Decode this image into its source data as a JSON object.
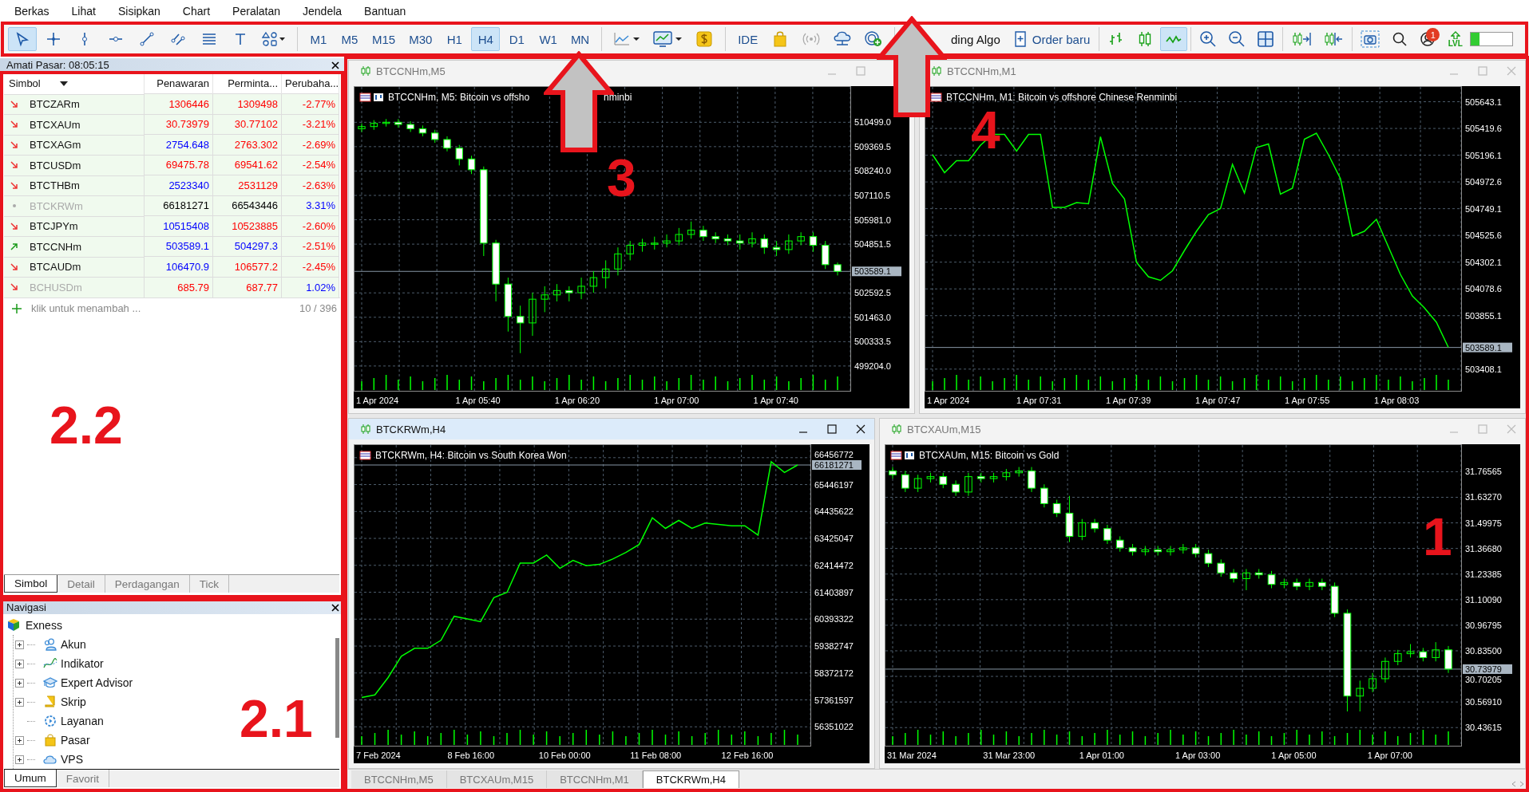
{
  "menu": [
    "Berkas",
    "Lihat",
    "Sisipkan",
    "Chart",
    "Peralatan",
    "Jendela",
    "Bantuan"
  ],
  "toolbar": {
    "drawing_tools": [
      {
        "kind": "cursor",
        "selected": true
      },
      {
        "kind": "crosshair",
        "selected": false
      },
      {
        "kind": "vline",
        "selected": false
      },
      {
        "kind": "hline",
        "selected": false
      },
      {
        "kind": "trendline",
        "selected": false
      },
      {
        "kind": "channel",
        "selected": false
      },
      {
        "kind": "fibo",
        "selected": false
      },
      {
        "kind": "text",
        "selected": false
      },
      {
        "kind": "shapes",
        "selected": false
      }
    ],
    "timeframes": [
      {
        "label": "M1",
        "selected": false
      },
      {
        "label": "M5",
        "selected": false
      },
      {
        "label": "M15",
        "selected": false
      },
      {
        "label": "M30",
        "selected": false
      },
      {
        "label": "H1",
        "selected": false
      },
      {
        "label": "H4",
        "selected": true
      },
      {
        "label": "D1",
        "selected": false
      },
      {
        "label": "W1",
        "selected": false
      },
      {
        "label": "MN",
        "selected": false
      }
    ],
    "ide_label": "IDE",
    "algo_label": "ding Algo",
    "order_label": "Order baru",
    "chart_types": [
      {
        "kind": "bars",
        "selected": false
      },
      {
        "kind": "candles",
        "selected": false
      },
      {
        "kind": "line",
        "selected": true
      }
    ],
    "notification_badge": "1",
    "level_label": "LVL",
    "meter": {
      "level": 0.2
    }
  },
  "market_watch": {
    "title": "Amati Pasar: 08:05:15",
    "columns": [
      "Simbol",
      "Penawaran",
      "Perminta...",
      "Perubaha..."
    ],
    "rows": [
      {
        "kind": "falling",
        "symbol": "BTCZARm",
        "inactive": false,
        "bid": {
          "text": "1306446",
          "color": "#ff0000"
        },
        "ask": {
          "text": "1309498",
          "color": "#ff0000"
        },
        "change": {
          "text": "-2.77%",
          "color": "#ff0000"
        }
      },
      {
        "kind": "falling",
        "symbol": "BTCXAUm",
        "inactive": false,
        "bid": {
          "text": "30.73979",
          "color": "#ff0000"
        },
        "ask": {
          "text": "30.77102",
          "color": "#ff0000"
        },
        "change": {
          "text": "-3.21%",
          "color": "#ff0000"
        }
      },
      {
        "kind": "falling",
        "symbol": "BTCXAGm",
        "inactive": false,
        "bid": {
          "text": "2754.648",
          "color": "#0000ff"
        },
        "ask": {
          "text": "2763.302",
          "color": "#ff0000"
        },
        "change": {
          "text": "-2.69%",
          "color": "#ff0000"
        }
      },
      {
        "kind": "falling",
        "symbol": "BTCUSDm",
        "inactive": false,
        "bid": {
          "text": "69475.78",
          "color": "#ff0000"
        },
        "ask": {
          "text": "69541.62",
          "color": "#ff0000"
        },
        "change": {
          "text": "-2.54%",
          "color": "#ff0000"
        }
      },
      {
        "kind": "falling",
        "symbol": "BTCTHBm",
        "inactive": false,
        "bid": {
          "text": "2523340",
          "color": "#0000ff"
        },
        "ask": {
          "text": "2531129",
          "color": "#ff0000"
        },
        "change": {
          "text": "-2.63%",
          "color": "#ff0000"
        }
      },
      {
        "kind": "unchanged",
        "symbol": "BTCKRWm",
        "inactive": true,
        "bid": {
          "text": "66181271",
          "color": "#000000"
        },
        "ask": {
          "text": "66543446",
          "color": "#000000"
        },
        "change": {
          "text": "3.31%",
          "color": "#0000ff"
        }
      },
      {
        "kind": "falling",
        "symbol": "BTCJPYm",
        "inactive": false,
        "bid": {
          "text": "10515408",
          "color": "#0000ff"
        },
        "ask": {
          "text": "10523885",
          "color": "#ff0000"
        },
        "change": {
          "text": "-2.60%",
          "color": "#ff0000"
        }
      },
      {
        "kind": "rising",
        "symbol": "BTCCNHm",
        "inactive": false,
        "bid": {
          "text": "503589.1",
          "color": "#0000ff"
        },
        "ask": {
          "text": "504297.3",
          "color": "#0000ff"
        },
        "change": {
          "text": "-2.51%",
          "color": "#ff0000"
        }
      },
      {
        "kind": "falling",
        "symbol": "BTCAUDm",
        "inactive": false,
        "bid": {
          "text": "106470.9",
          "color": "#0000ff"
        },
        "ask": {
          "text": "106577.2",
          "color": "#ff0000"
        },
        "change": {
          "text": "-2.45%",
          "color": "#ff0000"
        }
      },
      {
        "kind": "falling",
        "symbol": "BCHUSDm",
        "inactive": true,
        "bid": {
          "text": "685.79",
          "color": "#ff0000"
        },
        "ask": {
          "text": "687.77",
          "color": "#ff0000"
        },
        "change": {
          "text": "1.02%",
          "color": "#0000ff"
        }
      }
    ],
    "add_label": "klik untuk menambah ...",
    "count": "10 / 396",
    "tabs": [
      {
        "label": "Simbol",
        "selected": true
      },
      {
        "label": "Detail",
        "selected": false
      },
      {
        "label": "Perdagangan",
        "selected": false
      },
      {
        "label": "Tick",
        "selected": false
      }
    ]
  },
  "navigator": {
    "title": "Navigasi",
    "tree": [
      {
        "label": "Exness",
        "children": [
          {
            "label": "Akun",
            "expanded": false
          },
          {
            "label": "Indikator",
            "expanded": false
          },
          {
            "label": "Expert Advisor",
            "expanded": false
          },
          {
            "label": "Skrip",
            "expanded": false
          },
          {
            "label": "Layanan"
          },
          {
            "label": "Pasar",
            "expanded": false
          },
          {
            "label": "VPS",
            "expanded": false
          }
        ]
      }
    ],
    "tabs": [
      {
        "label": "Umum",
        "selected": true
      },
      {
        "label": "Favorit",
        "selected": false
      }
    ]
  },
  "charts": [
    {
      "title": "BTCCNHm,M5",
      "active": false,
      "closable": false,
      "header": "BTCCNHm, M5:  Bitcoin vs offsho",
      "header_tail": "nminbi",
      "time_labels": [
        "1 Apr 2024",
        "1 Apr 05:40",
        "1 Apr 06:20",
        "1 Apr 07:00",
        "1 Apr 07:40"
      ],
      "chart_data": {
        "type": "candlestick",
        "grid": true,
        "ylim": [
          498128,
          512100
        ],
        "yticks": [
          {
            "value": 510499.0,
            "label": "510499.0"
          },
          {
            "value": 509369.5,
            "label": "509369.5"
          },
          {
            "value": 508240.0,
            "label": "508240.0"
          },
          {
            "value": 507110.5,
            "label": "507110.5"
          },
          {
            "value": 505981.0,
            "label": "505981.0"
          },
          {
            "value": 504851.5,
            "label": "504851.5"
          },
          {
            "value": 502592.5,
            "label": "502592.5"
          },
          {
            "value": 501463.0,
            "label": "501463.0"
          },
          {
            "value": 500333.5,
            "label": "500333.5"
          },
          {
            "value": 499204.0,
            "label": "499204.0"
          }
        ],
        "ref_lines": [
          {
            "axis": "y",
            "value": 503589.1,
            "label": "503589.1"
          }
        ],
        "ohlc": [
          [
            510200,
            510450,
            510050,
            510300
          ],
          [
            510300,
            510600,
            510150,
            510450
          ],
          [
            510450,
            510650,
            510300,
            510500
          ],
          [
            510500,
            510650,
            510250,
            510400
          ],
          [
            510400,
            510550,
            510050,
            510200
          ],
          [
            510200,
            510350,
            509850,
            510000
          ],
          [
            510000,
            510150,
            509550,
            509700
          ],
          [
            509700,
            509850,
            509150,
            509300
          ],
          [
            509300,
            509450,
            508500,
            508800
          ],
          [
            508800,
            508950,
            508100,
            508300
          ],
          [
            508300,
            508450,
            504300,
            504900
          ],
          [
            504900,
            505050,
            502200,
            503000
          ],
          [
            503000,
            503300,
            500800,
            501500
          ],
          [
            501500,
            502000,
            499800,
            501200
          ],
          [
            501200,
            502600,
            500600,
            502300
          ],
          [
            502300,
            502900,
            501700,
            502500
          ],
          [
            502500,
            503000,
            502200,
            502700
          ],
          [
            502700,
            502900,
            502200,
            502600
          ],
          [
            502600,
            503300,
            502300,
            502900
          ],
          [
            502900,
            503600,
            502600,
            503300
          ],
          [
            503300,
            504100,
            502800,
            503700
          ],
          [
            503700,
            504700,
            503400,
            504400
          ],
          [
            504400,
            505000,
            504100,
            504800
          ],
          [
            504800,
            505100,
            504500,
            504900
          ],
          [
            504900,
            505200,
            504600,
            504900
          ],
          [
            504900,
            505300,
            504700,
            505000
          ],
          [
            505000,
            505600,
            504800,
            505300
          ],
          [
            505300,
            505900,
            505100,
            505500
          ],
          [
            505500,
            505700,
            505000,
            505200
          ],
          [
            505200,
            505400,
            504900,
            505100
          ],
          [
            505100,
            505300,
            504800,
            505000
          ],
          [
            505000,
            505300,
            504600,
            504900
          ],
          [
            504900,
            505400,
            504700,
            505100
          ],
          [
            505100,
            505300,
            504400,
            504700
          ],
          [
            504700,
            505000,
            504300,
            504600
          ],
          [
            504600,
            505300,
            504400,
            505000
          ],
          [
            505000,
            505400,
            504800,
            505200
          ],
          [
            505200,
            505400,
            504500,
            504800
          ],
          [
            504800,
            505000,
            503700,
            503900
          ],
          [
            503900,
            504000,
            503400,
            503590
          ]
        ]
      }
    },
    {
      "title": "BTCCNHm,M1",
      "active": false,
      "closable": true,
      "header": "BTCCNHm, M1:  Bitcoin vs offshore Chinese Renminbi",
      "time_labels": [
        "1 Apr 2024",
        "1 Apr 07:31",
        "1 Apr 07:39",
        "1 Apr 07:47",
        "1 Apr 07:55",
        "1 Apr 08:03"
      ],
      "chart_data": {
        "type": "line",
        "grid": true,
        "ylim": [
          503240,
          505760
        ],
        "yticks": [
          {
            "value": 505643.1,
            "label": "505643.1"
          },
          {
            "value": 505419.6,
            "label": "505419.6"
          },
          {
            "value": 505196.1,
            "label": "505196.1"
          },
          {
            "value": 504972.6,
            "label": "504972.6"
          },
          {
            "value": 504749.1,
            "label": "504749.1"
          },
          {
            "value": 504525.6,
            "label": "504525.6"
          },
          {
            "value": 504302.1,
            "label": "504302.1"
          },
          {
            "value": 504078.6,
            "label": "504078.6"
          },
          {
            "value": 503855.1,
            "label": "503855.1"
          },
          {
            "value": 503408.1,
            "label": "503408.1"
          }
        ],
        "ref_lines": [
          {
            "axis": "y",
            "value": 503589.1,
            "label": "503589.1"
          }
        ],
        "series": [
          {
            "color": "#00ff00",
            "values": [
              505200,
              505050,
              505150,
              505150,
              505280,
              505370,
              505370,
              505230,
              505370,
              505370,
              504760,
              504760,
              504800,
              504790,
              505350,
              504960,
              504830,
              504300,
              504180,
              504150,
              504230,
              504400,
              504560,
              504700,
              504750,
              505120,
              504880,
              505260,
              505290,
              504870,
              504920,
              505330,
              505380,
              505200,
              505000,
              504520,
              504560,
              504660,
              504430,
              504200,
              504020,
              503920,
              503800,
              503590
            ]
          }
        ]
      }
    },
    {
      "title": "BTCKRWm,H4",
      "active": true,
      "closable": true,
      "header": "BTCKRWm, H4:  Bitcoin vs South Korea Won",
      "time_labels": [
        "7 Feb 2024",
        "8 Feb 16:00",
        "10 Feb 00:00",
        "11 Feb 08:00",
        "12 Feb 16:00"
      ],
      "chart_data": {
        "type": "line",
        "grid": true,
        "ylim": [
          55700000,
          66900000
        ],
        "yticks": [
          {
            "value": 66456772,
            "label": "66456772"
          },
          {
            "value": 65446197,
            "label": "65446197"
          },
          {
            "value": 64435622,
            "label": "64435622"
          },
          {
            "value": 63425047,
            "label": "63425047"
          },
          {
            "value": 62414472,
            "label": "62414472"
          },
          {
            "value": 61403897,
            "label": "61403897"
          },
          {
            "value": 60393322,
            "label": "60393322"
          },
          {
            "value": 59382747,
            "label": "59382747"
          },
          {
            "value": 58372172,
            "label": "58372172"
          },
          {
            "value": 57361597,
            "label": "57361597"
          },
          {
            "value": 56351022,
            "label": "56351022"
          }
        ],
        "ref_lines": [
          {
            "axis": "y",
            "value": 66181271,
            "label": "66181271"
          }
        ],
        "series": [
          {
            "color": "#00ff00",
            "values": [
              57450000,
              57550000,
              58200000,
              59000000,
              59300000,
              59300000,
              59600000,
              60500000,
              60400000,
              60300000,
              61200000,
              61400000,
              62500000,
              62500000,
              62800000,
              62300000,
              62600000,
              62400000,
              62450000,
              62650000,
              62900000,
              63200000,
              64200000,
              63800000,
              64100000,
              63800000,
              64000000,
              63950000,
              63900000,
              63900000,
              63550000,
              66300000,
              65900000,
              66180000
            ]
          }
        ]
      }
    },
    {
      "title": "BTCXAUm,M15",
      "active": false,
      "closable": true,
      "header": "BTCXAUm, M15:  Bitcoin vs Gold",
      "time_labels": [
        "31 Mar 2024",
        "31 Mar 23:00",
        "1 Apr 01:00",
        "1 Apr 03:00",
        "1 Apr 05:00",
        "1 Apr 07:00"
      ],
      "chart_data": {
        "type": "candlestick",
        "grid": true,
        "ylim": [
          30.35,
          31.9
        ],
        "yticks": [
          {
            "value": 31.76565,
            "label": "31.76565"
          },
          {
            "value": 31.6327,
            "label": "31.63270"
          },
          {
            "value": 31.49975,
            "label": "31.49975"
          },
          {
            "value": 31.3668,
            "label": "31.36680"
          },
          {
            "value": 31.23385,
            "label": "31.23385"
          },
          {
            "value": 31.1009,
            "label": "31.10090"
          },
          {
            "value": 30.96795,
            "label": "30.96795"
          },
          {
            "value": 30.835,
            "label": "30.83500"
          },
          {
            "value": 30.70205,
            "label": "30.70205"
          },
          {
            "value": 30.5691,
            "label": "30.56910"
          },
          {
            "value": 30.43615,
            "label": "30.43615"
          }
        ],
        "ref_lines": [
          {
            "axis": "y",
            "value": 30.73979,
            "label": "30.73979"
          }
        ],
        "ohlc": [
          [
            31.77,
            31.79,
            31.73,
            31.75
          ],
          [
            31.75,
            31.77,
            31.66,
            31.68
          ],
          [
            31.68,
            31.75,
            31.66,
            31.73
          ],
          [
            31.73,
            31.76,
            31.71,
            31.74
          ],
          [
            31.74,
            31.76,
            31.68,
            31.7
          ],
          [
            31.7,
            31.72,
            31.64,
            31.66
          ],
          [
            31.66,
            31.76,
            31.64,
            31.74
          ],
          [
            31.74,
            31.76,
            31.71,
            31.73
          ],
          [
            31.73,
            31.76,
            31.71,
            31.74
          ],
          [
            31.74,
            31.78,
            31.72,
            31.76
          ],
          [
            31.76,
            31.79,
            31.74,
            31.77
          ],
          [
            31.77,
            31.79,
            31.66,
            31.68
          ],
          [
            31.68,
            31.7,
            31.58,
            31.6
          ],
          [
            31.6,
            31.62,
            31.53,
            31.55
          ],
          [
            31.55,
            31.64,
            31.4,
            31.43
          ],
          [
            31.43,
            31.52,
            31.41,
            31.5
          ],
          [
            31.5,
            31.52,
            31.45,
            31.47
          ],
          [
            31.47,
            31.49,
            31.39,
            31.41
          ],
          [
            31.41,
            31.43,
            31.35,
            31.37
          ],
          [
            31.37,
            31.39,
            31.33,
            31.35
          ],
          [
            31.35,
            31.38,
            31.33,
            31.36
          ],
          [
            31.36,
            31.38,
            31.33,
            31.35
          ],
          [
            31.35,
            31.38,
            31.33,
            31.36
          ],
          [
            31.36,
            31.39,
            31.34,
            31.37
          ],
          [
            31.37,
            31.39,
            31.32,
            31.34
          ],
          [
            31.34,
            31.36,
            31.27,
            31.29
          ],
          [
            31.29,
            31.31,
            31.22,
            31.24
          ],
          [
            31.24,
            31.26,
            31.19,
            31.21
          ],
          [
            31.21,
            31.26,
            31.15,
            31.24
          ],
          [
            31.24,
            31.26,
            31.21,
            31.23
          ],
          [
            31.23,
            31.25,
            31.16,
            31.18
          ],
          [
            31.18,
            31.21,
            31.16,
            31.19
          ],
          [
            31.19,
            31.21,
            31.15,
            31.17
          ],
          [
            31.17,
            31.21,
            31.15,
            31.19
          ],
          [
            31.19,
            31.21,
            31.15,
            31.17
          ],
          [
            31.17,
            31.19,
            31.01,
            31.03
          ],
          [
            31.03,
            31.05,
            30.52,
            30.6
          ],
          [
            30.6,
            30.68,
            30.52,
            30.64
          ],
          [
            30.64,
            30.72,
            30.62,
            30.69
          ],
          [
            30.69,
            30.8,
            30.67,
            30.78
          ],
          [
            30.78,
            30.84,
            30.76,
            30.82
          ],
          [
            30.82,
            30.87,
            30.8,
            30.83
          ],
          [
            30.83,
            30.85,
            30.78,
            30.8
          ],
          [
            30.8,
            30.88,
            30.78,
            30.84
          ],
          [
            30.84,
            30.86,
            30.72,
            30.74
          ]
        ]
      }
    }
  ],
  "chart_tabs": [
    {
      "label": "BTCCNHm,M5",
      "selected": false
    },
    {
      "label": "BTCXAUm,M15",
      "selected": false
    },
    {
      "label": "BTCCNHm,M1",
      "selected": false
    },
    {
      "label": "BTCKRWm,H4",
      "selected": true
    }
  ],
  "annotations": [
    {
      "label": "2.2"
    },
    {
      "label": "2.1"
    },
    {
      "label": "3"
    },
    {
      "label": "4"
    },
    {
      "label": "1"
    }
  ]
}
